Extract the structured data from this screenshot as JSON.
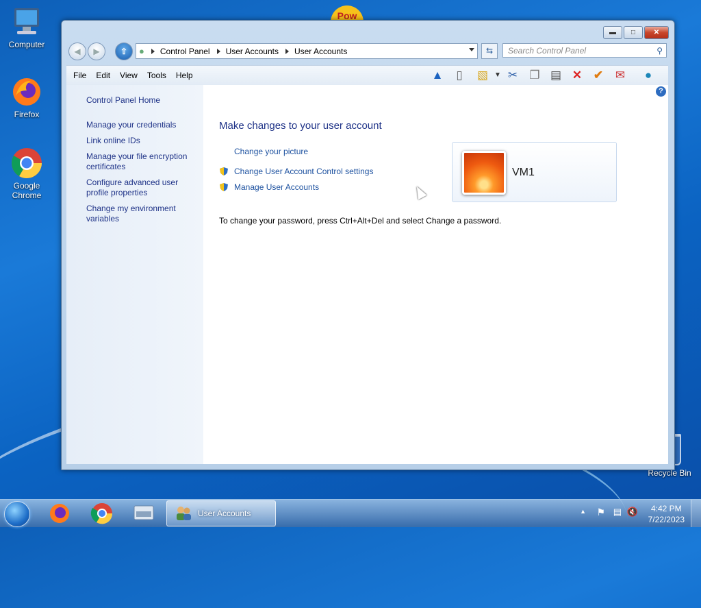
{
  "desktop": {
    "icons": [
      {
        "label": "Computer"
      },
      {
        "label": "Firefox"
      },
      {
        "label": "Google Chrome"
      },
      {
        "label": "Recycle Bin"
      }
    ],
    "partial_label": "Pow"
  },
  "window": {
    "address": {
      "crumbs": [
        "Control Panel",
        "User Accounts",
        "User Accounts"
      ]
    },
    "search_placeholder": "Search Control Panel",
    "menu": [
      "File",
      "Edit",
      "View",
      "Tools",
      "Help"
    ],
    "left_pane": {
      "home": "Control Panel Home",
      "links": [
        "Manage your credentials",
        "Link online IDs",
        "Manage your file encryption certificates",
        "Configure advanced user profile properties",
        "Change my environment variables"
      ]
    },
    "main": {
      "heading": "Make changes to your user account",
      "tasks": [
        "Change your picture",
        "Change User Account Control settings",
        "Manage User Accounts"
      ],
      "note": "To change your password, press Ctrl+Alt+Del and select Change a password."
    },
    "account": {
      "name": "VM1"
    }
  },
  "taskbar": {
    "active_app": "User Accounts",
    "time": "4:42 PM",
    "date": "7/22/2023"
  },
  "colors": {
    "link": "#1e52a0",
    "heading": "#1e3287",
    "desktop": "#1a7ad8"
  }
}
